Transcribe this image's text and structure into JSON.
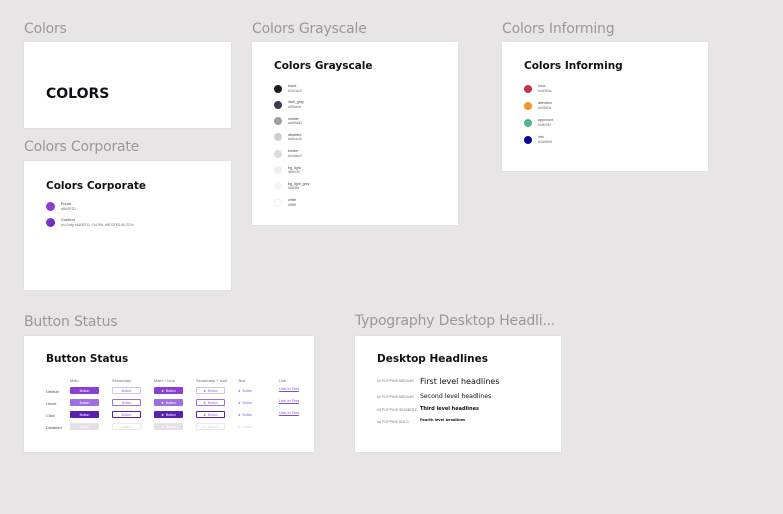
{
  "frames": {
    "colors": {
      "label": "Colors",
      "heading": "COLORS"
    },
    "grayscale": {
      "label": "Colors Grayscale",
      "title": "Colors Grayscale",
      "swatches": [
        {
          "name": "black",
          "hex": "#1b1a22",
          "color": "#1b1a22"
        },
        {
          "name": "dark_gray",
          "hex": "#3f3a4b",
          "color": "#3f3a4b"
        },
        {
          "name": "middle",
          "hex": "#a09da3",
          "color": "#a09da3"
        },
        {
          "name": "disabled",
          "hex": "#d0ccd4",
          "color": "#d0ccd4"
        },
        {
          "name": "border",
          "hex": "#e0dbe2",
          "color": "#e0dbe2"
        },
        {
          "name": "bg_light",
          "hex": "#f0ecf0",
          "color": "#f0ecf0"
        },
        {
          "name": "bg_light_grey",
          "hex": "#f5f3f5",
          "color": "#f5f3f5"
        },
        {
          "name": "white",
          "hex": "#ffffff",
          "color": "#ffffff"
        }
      ]
    },
    "informing": {
      "label": "Colors Informing",
      "title": "Colors Informing",
      "swatches": [
        {
          "name": "error",
          "hex": "#c8304c",
          "color": "#c8304c"
        },
        {
          "name": "attention",
          "hex": "#f2952d",
          "color": "#f2952d"
        },
        {
          "name": "approved",
          "hex": "#4fb394",
          "color": "#4fb394"
        },
        {
          "name": "info",
          "hex": "#0d0896",
          "color": "#0d0896"
        }
      ]
    },
    "corporate": {
      "label": "Colors Corporate",
      "title": "Colors Corporate",
      "swatches": [
        {
          "name": "Purple",
          "hex": "#8A3FD1",
          "color": "#8a3fd1"
        },
        {
          "name": "Gradient",
          "hex": "lin-Grdg #8A3FD1 +14.5%, #6D2FE5 80.22%",
          "color": "#6b2fc2"
        }
      ]
    },
    "buttons": {
      "label": "Button Status",
      "title": "Button Status",
      "columns": [
        "Main",
        "Secondary",
        "Main + Icon",
        "Secondary + Icon",
        "Text",
        "Link"
      ],
      "rows": [
        "Default",
        "Hover",
        "Click",
        "Disabled"
      ],
      "button_label": "Button",
      "link_label": "Link in Text",
      "colors": {
        "main": "#8a3fd1",
        "hover": "#a06ee0",
        "click": "#5a1fb0",
        "disabled": "#e3e0e6"
      }
    },
    "typography": {
      "label": "Typography Desktop Headli...",
      "title": "Desktop Headlines",
      "levels": [
        {
          "meta": "h1 POPPINS MEDIUM",
          "sample": "First level headlines"
        },
        {
          "meta": "h2 POPPINS MEDIUM",
          "sample": "Second level headlines"
        },
        {
          "meta": "h3 POPPINS SEMIBOLD",
          "sample": "Third level headlines"
        },
        {
          "meta": "h4 POPPINS BOLD",
          "sample": "Fourth level headlines"
        }
      ]
    }
  }
}
